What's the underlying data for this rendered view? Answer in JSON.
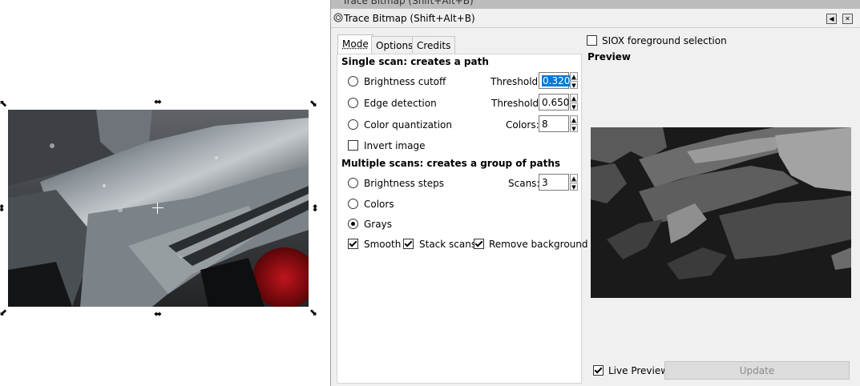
{
  "window": {
    "partial_title": "Trace Bitmap (Shift+Alt+B)",
    "title": "Trace Bitmap (Shift+Alt+B)"
  },
  "tabs": [
    {
      "label": "Mode",
      "active": true
    },
    {
      "label": "Options",
      "active": false
    },
    {
      "label": "Credits",
      "active": false
    }
  ],
  "single_scan": {
    "header": "Single scan: creates a path",
    "brightness_cutoff": {
      "label": "Brightness cutoff",
      "param_label": "Threshold:",
      "value": "0.320",
      "selected": false
    },
    "edge_detection": {
      "label": "Edge detection",
      "param_label": "Threshold:",
      "value": "0.650",
      "selected": false
    },
    "color_quantization": {
      "label": "Color quantization",
      "param_label": "Colors:",
      "value": "8",
      "selected": false
    },
    "invert_image": {
      "label": "Invert image",
      "checked": false
    }
  },
  "multiple_scans": {
    "header": "Multiple scans: creates a group of paths",
    "brightness_steps": {
      "label": "Brightness steps",
      "param_label": "Scans:",
      "value": "3",
      "selected": false
    },
    "colors": {
      "label": "Colors",
      "selected": false
    },
    "grays": {
      "label": "Grays",
      "selected": true
    },
    "smooth": {
      "label": "Smooth",
      "checked": true
    },
    "stack_scans": {
      "label": "Stack scans",
      "checked": true
    },
    "remove_background": {
      "label": "Remove background",
      "checked": true
    }
  },
  "siox": {
    "label": "SIOX foreground selection",
    "checked": false
  },
  "preview": {
    "label": "Preview"
  },
  "live_preview": {
    "label": "Live Preview",
    "checked": true
  },
  "update_button": {
    "label": "Update",
    "enabled": false
  },
  "colors": {
    "dialog_bg": "#f0f0f0",
    "selection_highlight": "#0078d7",
    "bitmap_red": "#8b0d12"
  }
}
